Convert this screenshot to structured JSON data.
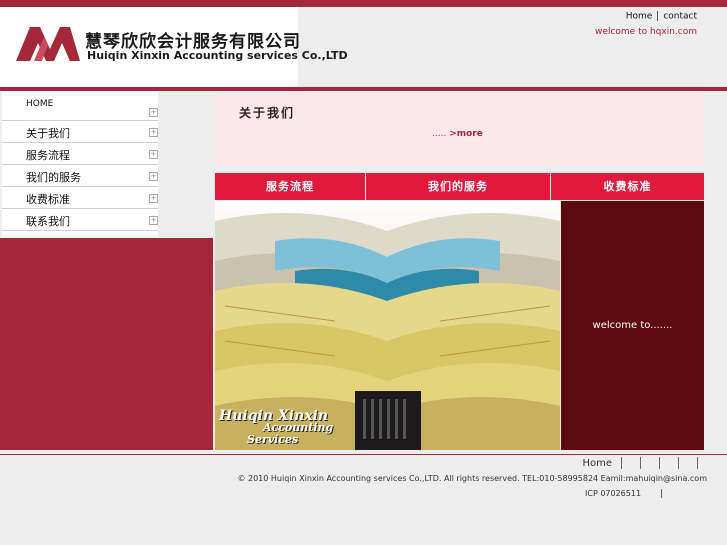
{
  "header": {
    "logo_cn": "慧琴欣欣会计服务有限公司",
    "logo_en": "Huiqin Xinxin Accounting services Co.,LTD",
    "links": [
      "Home",
      "contact"
    ],
    "welcome": "welcome to hqxin.com"
  },
  "sidebar": {
    "items": [
      {
        "label": "HOME"
      },
      {
        "label": "关于我们"
      },
      {
        "label": "服务流程"
      },
      {
        "label": "我们的服务"
      },
      {
        "label": "收费标准"
      },
      {
        "label": "联系我们"
      }
    ]
  },
  "about": {
    "title": "关于我们",
    "more_dots": ".....",
    "more_label": ">more"
  },
  "tabs": [
    {
      "label": "服务流程"
    },
    {
      "label": "我们的服务"
    },
    {
      "label": "收费标准"
    }
  ],
  "photo": {
    "caption_line1": "Huiqin Xinxin",
    "caption_line2": "Accounting",
    "caption_line3": "Services"
  },
  "welcome_panel": {
    "text": "welcome to......."
  },
  "footer": {
    "nav": [
      "Home",
      "",
      "",
      "",
      "",
      ""
    ],
    "copyright": "© 2010 Huiqin Xinxin Accounting services Co.,LTD. All rights reserved. TEL:010-58995824 Eamil:mahuiqin@sina.com",
    "icp": "ICP 07026511"
  },
  "colors": {
    "brand_red": "#a5273a",
    "tab_red": "#e1193c",
    "panel_dark": "#5c0c0f",
    "about_bg": "#fce8ea"
  }
}
